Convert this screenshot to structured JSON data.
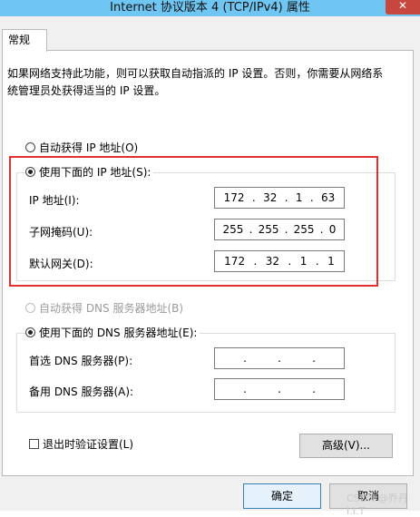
{
  "window": {
    "title": "Internet 协议版本 4 (TCP/IPv4) 属性",
    "close_glyph": "✕"
  },
  "tabs": [
    {
      "label": "常规",
      "selected": true
    }
  ],
  "description": "如果网络支持此功能，则可以获取自动指派的 IP 设置。否则，你需要从网络系统管理员处获得适当的 IP 设置。",
  "ip_section": {
    "auto_option": {
      "label": "自动获得 IP 地址(O)",
      "checked": false
    },
    "manual_option": {
      "label": "使用下面的 IP 地址(S):",
      "checked": true
    },
    "fields": [
      {
        "label": "IP 地址(I):",
        "octets": [
          "172",
          "32",
          "1",
          "63"
        ]
      },
      {
        "label": "子网掩码(U):",
        "octets": [
          "255",
          "255",
          "255",
          "0"
        ]
      },
      {
        "label": "默认网关(D):",
        "octets": [
          "172",
          "32",
          "1",
          "1"
        ]
      }
    ]
  },
  "dns_section": {
    "auto_option": {
      "label": "自动获得 DNS 服务器地址(B)",
      "checked": false,
      "disabled": true
    },
    "manual_option": {
      "label": "使用下面的 DNS 服务器地址(E):",
      "checked": true
    },
    "fields": [
      {
        "label": "首选 DNS 服务器(P):",
        "octets": [
          "",
          "",
          "",
          ""
        ]
      },
      {
        "label": "备用 DNS 服务器(A):",
        "octets": [
          "",
          "",
          "",
          ""
        ]
      }
    ]
  },
  "validate_on_exit": {
    "label": "退出时验证设置(L)",
    "checked": false
  },
  "buttons": {
    "advanced": "高级(V)...",
    "ok": "确定",
    "cancel": "取消"
  },
  "dot": ".",
  "watermark": "CSDN @乔丹I.I.T",
  "colors": {
    "titlebar": "#6fc6f2",
    "close": "#c7463d",
    "highlight": "#e02f2f"
  }
}
